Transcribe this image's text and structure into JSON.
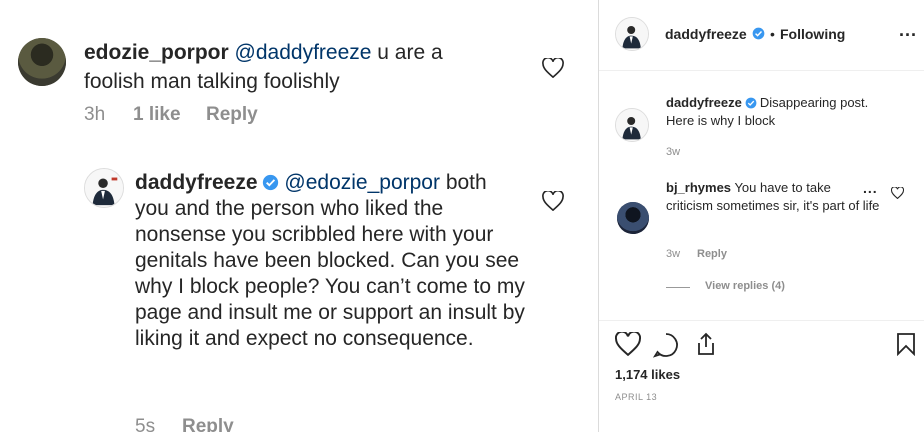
{
  "left": {
    "comment1": {
      "username": "edozie_porpor",
      "mention": "@daddyfreeze",
      "text": " u are a foolish man talking foolishly",
      "time": "3h",
      "likes": "1 like",
      "reply": "Reply"
    },
    "comment2": {
      "username": "daddyfreeze",
      "mention": "@edozie_porpor",
      "text": "both you and the person who liked the nonsense you scribbled here with your genitals have been blocked. Can you see why I block people? You can’t come to my page and insult me or support an insult by liking it and expect no consequence.",
      "time": "5s",
      "reply": "Reply"
    }
  },
  "right": {
    "header": {
      "username": "daddyfreeze",
      "separator": "•",
      "follow_state": "Following",
      "more": "..."
    },
    "caption": {
      "username": "daddyfreeze",
      "text": "Disappearing post. Here is why I block",
      "time": "3w"
    },
    "comment": {
      "username": "bj_rhymes",
      "text": "You have to take criticism sometimes sir, it's part of life",
      "time": "3w",
      "reply": "Reply",
      "more": "...",
      "view_replies": "View replies (4)"
    },
    "likes": "1,174 likes",
    "date": "APRIL 13"
  },
  "icons": {
    "heart": "heart-icon",
    "comment": "comment-icon",
    "share": "share-icon",
    "bookmark": "bookmark-icon",
    "verified": "verified-icon"
  },
  "colors": {
    "verified": "#3897f0",
    "mention": "#003569",
    "meta": "#8e8e8e"
  }
}
